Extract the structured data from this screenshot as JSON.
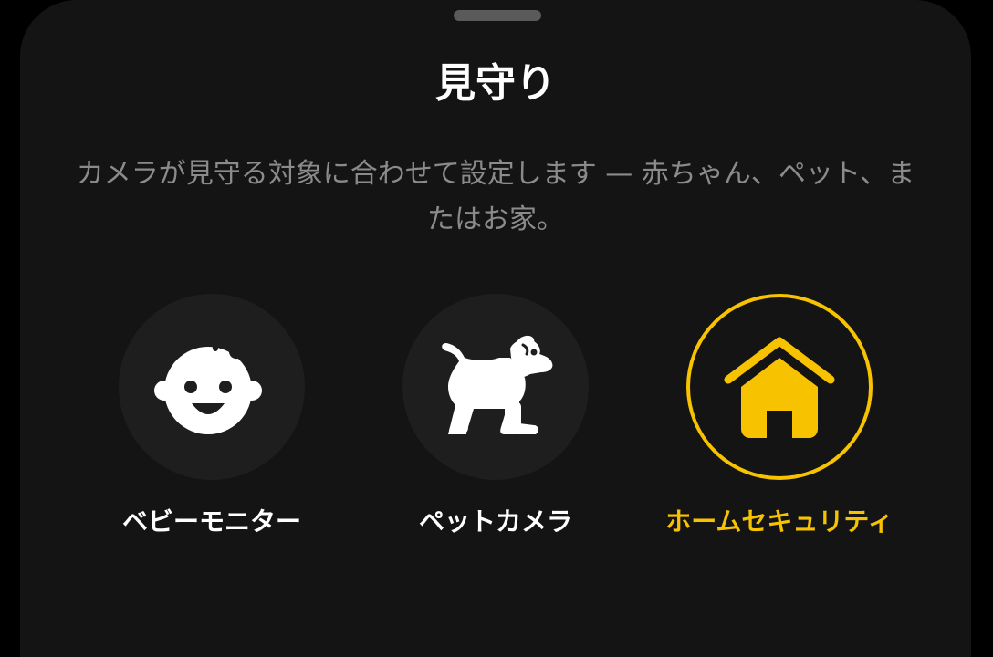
{
  "sheet": {
    "title": "見守り",
    "description": "カメラが見守る対象に合わせて設定します — 赤ちゃん、ペット、またはお家。"
  },
  "options": [
    {
      "label": "ベビーモニター",
      "icon": "baby-face-icon",
      "selected": false
    },
    {
      "label": "ペットカメラ",
      "icon": "dog-icon",
      "selected": false
    },
    {
      "label": "ホームセキュリティ",
      "icon": "house-icon",
      "selected": true
    }
  ],
  "colors": {
    "background": "#000000",
    "sheet": "#141414",
    "accent": "#f7c300",
    "text_primary": "#ffffff",
    "text_secondary": "#8b8b8b",
    "option_circle": "#1e1e1e"
  }
}
